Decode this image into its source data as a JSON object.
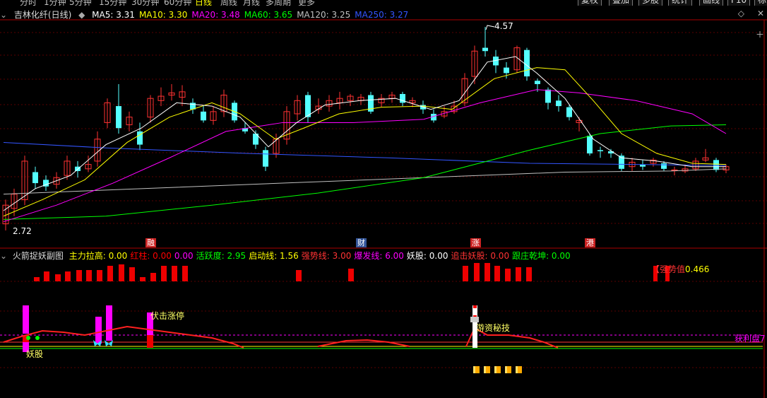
{
  "top_bar": {
    "timeframes": [
      "分时",
      "1分钟",
      "5分钟",
      "15分钟",
      "30分钟",
      "60分钟",
      "日线",
      "周线",
      "月线",
      "多周期",
      "更多"
    ],
    "active_timeframe": "日线",
    "right_buttons": [
      "复权",
      "叠加",
      "多股",
      "统计",
      "画线",
      "F10",
      "标记"
    ]
  },
  "main_chart": {
    "stock_title": "吉林化纤(日线)",
    "ma_legend": [
      {
        "label": "MA5: 3.31",
        "color": "#ffffff"
      },
      {
        "label": "MA10: 3.30",
        "color": "#ffff00"
      },
      {
        "label": "MA20: 3.48",
        "color": "#ff00ff"
      },
      {
        "label": "MA60: 3.65",
        "color": "#00ff00"
      },
      {
        "label": "MA120: 3.25",
        "color": "#c0c0c0"
      },
      {
        "label": "MA250: 3.27",
        "color": "#3355ff"
      }
    ],
    "high_label": "4.57",
    "low_label": "2.72",
    "event_markers": [
      {
        "text": "融",
        "color": "#cc2222"
      },
      {
        "text": "财",
        "color": "#335599"
      },
      {
        "text": "涨",
        "color": "#cc2222"
      },
      {
        "text": "港",
        "color": "#cc2222"
      }
    ]
  },
  "indicator": {
    "name": "火箭捉妖副图",
    "values": [
      {
        "label": "主力拉高: 0.00",
        "color": "#ffff00"
      },
      {
        "label": "红柱: 0.00",
        "color": "#ff0000"
      },
      {
        "label": "0.00",
        "color": "#ff00ff"
      },
      {
        "label": "活跃度: 2.95",
        "color": "#00ff00"
      },
      {
        "label": "启动线: 1.56",
        "color": "#ffff00"
      },
      {
        "label": "强势线: 3.00",
        "color": "#ff3333"
      },
      {
        "label": "爆发线: 6.00",
        "color": "#ff00ff"
      },
      {
        "label": "妖股: 0.00",
        "color": "#ffffff"
      },
      {
        "label": "追击妖股: 0.00",
        "color": "#ff3333"
      },
      {
        "label": "跟庄乾坤: 0.00",
        "color": "#00ff00"
      }
    ],
    "strength_label": "【强势值",
    "strength_value": "0.466",
    "profit_label": "获利盘7",
    "annotations": {
      "fu_ji": "伏击涨停",
      "yao_gu": "妖股",
      "you_zi": "游资秘技"
    }
  },
  "colors": {
    "up": "#ff3232",
    "down": "#54ffff",
    "grid": "#5a0000",
    "axis": "#b00000"
  }
}
